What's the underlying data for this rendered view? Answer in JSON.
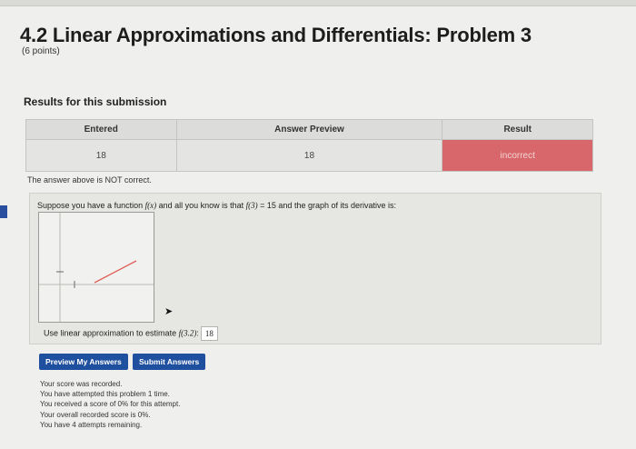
{
  "header": {
    "title": "4.2 Linear Approximations and Differentials: Problem 3",
    "points": "(6 points)"
  },
  "results": {
    "heading": "Results for this submission",
    "columns": [
      "Entered",
      "Answer Preview",
      "Result"
    ],
    "row": {
      "entered": "18",
      "preview": "18",
      "result": "incorrect"
    },
    "message": "The answer above is NOT correct."
  },
  "problem": {
    "statement_a": "Suppose you have a function ",
    "fx": "f(x)",
    "statement_b": " and all you know is that ",
    "f3": "f(3)",
    "statement_c": " = 15 and the graph of its derivative is:",
    "estimate_label": "Use linear approximation to estimate ",
    "f32": "f(3.2)",
    "colon": ":",
    "answer_value": "18"
  },
  "buttons": {
    "preview": "Preview My Answers",
    "submit": "Submit Answers"
  },
  "status_messages": [
    "Your score was recorded.",
    "You have attempted this problem 1 time.",
    "You received a score of 0% for this attempt.",
    "Your overall recorded score is 0%.",
    "You have 4 attempts remaining."
  ],
  "colors": {
    "incorrect": "#d8676b",
    "button": "#1f4f9f",
    "graph_line": "#e0605a"
  },
  "icons": [
    "pointer-cursor-icon"
  ]
}
